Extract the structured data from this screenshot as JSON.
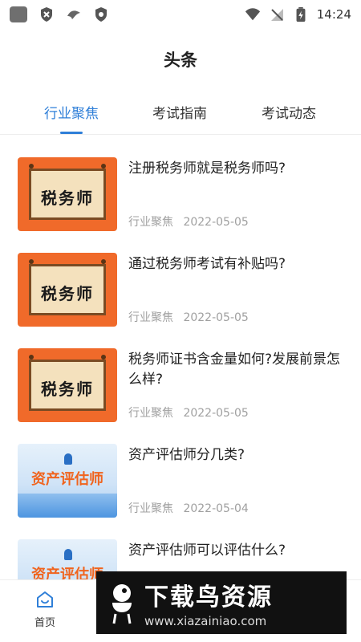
{
  "status_bar": {
    "time": "14:24",
    "left_icons": [
      "app-square-icon",
      "shield-x-icon",
      "bird-icon",
      "shield-icon"
    ],
    "right_icons": [
      "wifi-icon",
      "no-signal-icon",
      "battery-charging-icon"
    ]
  },
  "header": {
    "title": "头条"
  },
  "tabs": [
    {
      "label": "行业聚焦",
      "active": true
    },
    {
      "label": "考试指南",
      "active": false
    },
    {
      "label": "考试动态",
      "active": false
    }
  ],
  "articles": [
    {
      "title": "注册税务师就是税务师吗?",
      "category": "行业聚焦",
      "date": "2022-05-05",
      "thumb_text": "税务师"
    },
    {
      "title": "通过税务师考试有补贴吗?",
      "category": "行业聚焦",
      "date": "2022-05-05",
      "thumb_text": "税务师"
    },
    {
      "title": "税务师证书含金量如何?发展前景怎么样?",
      "category": "行业聚焦",
      "date": "2022-05-05",
      "thumb_text": "税务师"
    },
    {
      "title": "资产评估师分几类?",
      "category": "行业聚焦",
      "date": "2022-05-04",
      "thumb_text": "资产评估师"
    },
    {
      "title": "资产评估师可以评估什么?",
      "category": "",
      "date": "",
      "thumb_text": "资产评估师"
    }
  ],
  "bottom_nav": {
    "home_label": "首页"
  },
  "watermark": {
    "title": "下载鸟资源",
    "url": "www.xiazainiao.com"
  },
  "colors": {
    "accent": "#2f7fd8",
    "tax_thumb_bg": "#f06a2a",
    "meta_text": "#a0a0a0"
  }
}
